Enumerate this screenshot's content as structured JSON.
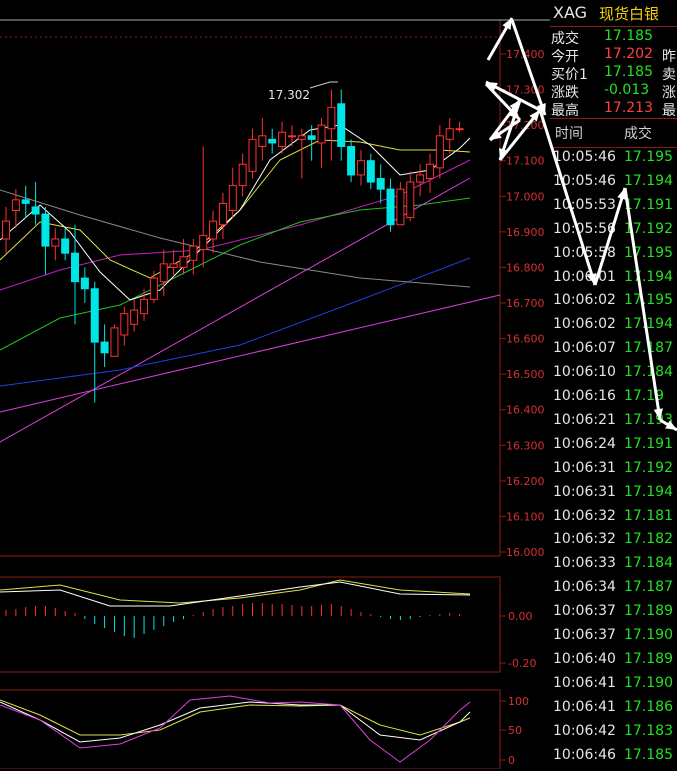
{
  "header": {
    "symbol": "XAG",
    "name": "现货白银"
  },
  "quote": [
    {
      "label": "成交",
      "value": "17.185",
      "color": "#22e022",
      "extra": ""
    },
    {
      "label": "今开",
      "value": "17.202",
      "color": "#ff4040",
      "extra": "昨"
    },
    {
      "label": "买价1",
      "value": "17.185",
      "color": "#22e022",
      "extra": "卖"
    },
    {
      "label": "涨跌",
      "value": "-0.013",
      "color": "#22e022",
      "extra": "涨"
    },
    {
      "label": "最高",
      "value": "17.213",
      "color": "#ff4040",
      "extra": "最"
    }
  ],
  "ticks_header": {
    "time": "时间",
    "price": "成交"
  },
  "ticks": [
    {
      "time": "10:05:46",
      "price": "17.195"
    },
    {
      "time": "10:05:46",
      "price": "17.194"
    },
    {
      "time": "10:05:53",
      "price": "17.191"
    },
    {
      "time": "10:05:56",
      "price": "17.192"
    },
    {
      "time": "10:05:58",
      "price": "17.195"
    },
    {
      "time": "10:06:01",
      "price": "17.194"
    },
    {
      "time": "10:06:02",
      "price": "17.195"
    },
    {
      "time": "10:06:02",
      "price": "17.194"
    },
    {
      "time": "10:06:07",
      "price": "17.187"
    },
    {
      "time": "10:06:10",
      "price": "17.184"
    },
    {
      "time": "10:06:16",
      "price": "17.19"
    },
    {
      "time": "10:06:21",
      "price": "17.193"
    },
    {
      "time": "10:06:24",
      "price": "17.191"
    },
    {
      "time": "10:06:31",
      "price": "17.192"
    },
    {
      "time": "10:06:31",
      "price": "17.194"
    },
    {
      "time": "10:06:32",
      "price": "17.181"
    },
    {
      "time": "10:06:32",
      "price": "17.182"
    },
    {
      "time": "10:06:33",
      "price": "17.184"
    },
    {
      "time": "10:06:34",
      "price": "17.187"
    },
    {
      "time": "10:06:37",
      "price": "17.189"
    },
    {
      "time": "10:06:37",
      "price": "17.190"
    },
    {
      "time": "10:06:40",
      "price": "17.189"
    },
    {
      "time": "10:06:41",
      "price": "17.190"
    },
    {
      "time": "10:06:41",
      "price": "17.186"
    },
    {
      "time": "10:06:42",
      "price": "17.183"
    },
    {
      "time": "10:06:46",
      "price": "17.185"
    }
  ],
  "chart_data": {
    "type": "candlestick",
    "price_ticks": [
      "17.400",
      "17.300",
      "17.200",
      "17.100",
      "17.000",
      "16.900",
      "16.800",
      "16.700",
      "16.600",
      "16.500",
      "16.400",
      "16.300",
      "16.200",
      "16.100",
      "16.000"
    ],
    "annotation": "17.302",
    "macd_ticks": [
      "0.00",
      "-0.20"
    ],
    "kdj_ticks": [
      "100",
      "50",
      "0"
    ],
    "colors": {
      "up": "#ff3030",
      "down": "#00e5e5",
      "grid": "#8b1a1a"
    },
    "candles": [
      {
        "o": 16.88,
        "h": 16.97,
        "l": 16.84,
        "c": 16.93
      },
      {
        "o": 16.96,
        "h": 17.02,
        "l": 16.91,
        "c": 16.99
      },
      {
        "o": 16.99,
        "h": 17.03,
        "l": 16.94,
        "c": 16.98
      },
      {
        "o": 16.97,
        "h": 17.04,
        "l": 16.92,
        "c": 16.95
      },
      {
        "o": 16.95,
        "h": 16.97,
        "l": 16.78,
        "c": 16.86
      },
      {
        "o": 16.86,
        "h": 16.91,
        "l": 16.82,
        "c": 16.88
      },
      {
        "o": 16.88,
        "h": 16.91,
        "l": 16.82,
        "c": 16.84
      },
      {
        "o": 16.84,
        "h": 16.92,
        "l": 16.64,
        "c": 16.76
      },
      {
        "o": 16.77,
        "h": 16.8,
        "l": 16.7,
        "c": 16.74
      },
      {
        "o": 16.74,
        "h": 16.76,
        "l": 16.42,
        "c": 16.59
      },
      {
        "o": 16.59,
        "h": 16.64,
        "l": 16.52,
        "c": 16.56
      },
      {
        "o": 16.55,
        "h": 16.64,
        "l": 16.55,
        "c": 16.63
      },
      {
        "o": 16.61,
        "h": 16.69,
        "l": 16.58,
        "c": 16.67
      },
      {
        "o": 16.64,
        "h": 16.71,
        "l": 16.62,
        "c": 16.68
      },
      {
        "o": 16.67,
        "h": 16.74,
        "l": 16.65,
        "c": 16.71
      },
      {
        "o": 16.71,
        "h": 16.79,
        "l": 16.7,
        "c": 16.77
      },
      {
        "o": 16.76,
        "h": 16.85,
        "l": 16.72,
        "c": 16.81
      },
      {
        "o": 16.8,
        "h": 16.85,
        "l": 16.78,
        "c": 16.81
      },
      {
        "o": 16.8,
        "h": 16.88,
        "l": 16.78,
        "c": 16.83
      },
      {
        "o": 16.82,
        "h": 16.88,
        "l": 16.78,
        "c": 16.86
      },
      {
        "o": 16.85,
        "h": 17.14,
        "l": 16.8,
        "c": 16.89
      },
      {
        "o": 16.88,
        "h": 16.96,
        "l": 16.84,
        "c": 16.93
      },
      {
        "o": 16.92,
        "h": 17.01,
        "l": 16.88,
        "c": 16.98
      },
      {
        "o": 16.96,
        "h": 17.08,
        "l": 16.94,
        "c": 17.03
      },
      {
        "o": 17.03,
        "h": 17.12,
        "l": 17.0,
        "c": 17.09
      },
      {
        "o": 17.07,
        "h": 17.19,
        "l": 17.05,
        "c": 17.16
      },
      {
        "o": 17.14,
        "h": 17.22,
        "l": 17.1,
        "c": 17.17
      },
      {
        "o": 17.16,
        "h": 17.19,
        "l": 17.12,
        "c": 17.15
      },
      {
        "o": 17.14,
        "h": 17.21,
        "l": 17.12,
        "c": 17.18
      },
      {
        "o": 17.17,
        "h": 17.2,
        "l": 17.14,
        "c": 17.17
      },
      {
        "o": 17.16,
        "h": 17.19,
        "l": 17.05,
        "c": 17.17
      },
      {
        "o": 17.17,
        "h": 17.2,
        "l": 17.1,
        "c": 17.16
      },
      {
        "o": 17.15,
        "h": 17.22,
        "l": 17.08,
        "c": 17.2
      },
      {
        "o": 17.19,
        "h": 17.3,
        "l": 17.1,
        "c": 17.25
      },
      {
        "o": 17.26,
        "h": 17.3,
        "l": 17.1,
        "c": 17.14
      },
      {
        "o": 17.14,
        "h": 17.16,
        "l": 17.04,
        "c": 17.06
      },
      {
        "o": 17.06,
        "h": 17.13,
        "l": 17.03,
        "c": 17.1
      },
      {
        "o": 17.1,
        "h": 17.12,
        "l": 17.02,
        "c": 17.04
      },
      {
        "o": 17.05,
        "h": 17.09,
        "l": 16.98,
        "c": 17.02
      },
      {
        "o": 17.02,
        "h": 17.05,
        "l": 16.9,
        "c": 16.92
      },
      {
        "o": 16.92,
        "h": 17.04,
        "l": 16.92,
        "c": 17.02
      },
      {
        "o": 16.94,
        "h": 17.07,
        "l": 16.93,
        "c": 17.04
      },
      {
        "o": 17.04,
        "h": 17.09,
        "l": 17.0,
        "c": 17.06
      },
      {
        "o": 17.05,
        "h": 17.12,
        "l": 17.01,
        "c": 17.09
      },
      {
        "o": 17.08,
        "h": 17.2,
        "l": 17.05,
        "c": 17.17
      },
      {
        "o": 17.16,
        "h": 17.22,
        "l": 17.12,
        "c": 17.19
      },
      {
        "o": 17.19,
        "h": 17.21,
        "l": 17.18,
        "c": 17.19
      }
    ]
  }
}
